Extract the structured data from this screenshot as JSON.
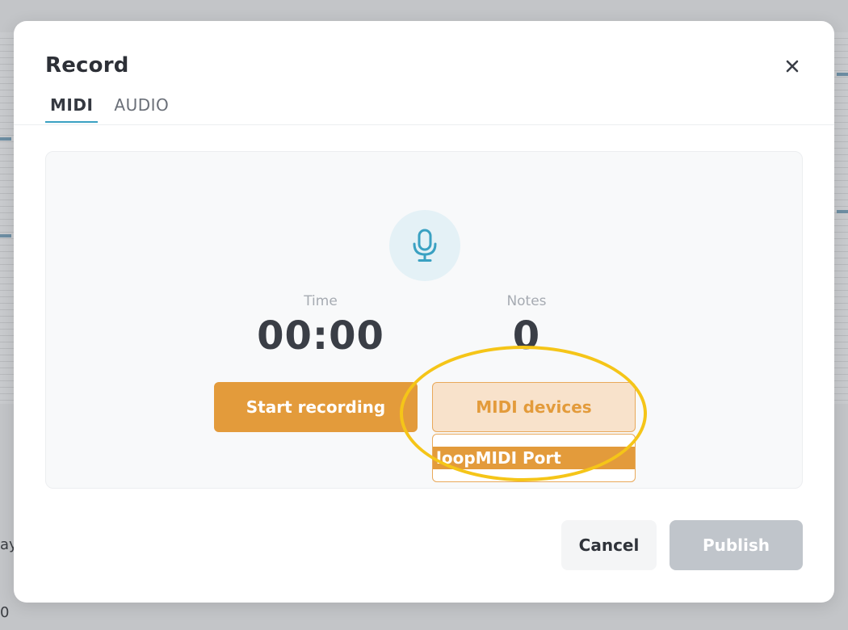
{
  "dialog": {
    "title": "Record",
    "tabs": [
      {
        "label": "MIDI",
        "active": true
      },
      {
        "label": "AUDIO",
        "active": false
      }
    ]
  },
  "recorder": {
    "icon": "microphone-icon",
    "time_label": "Time",
    "time_value": "00:00",
    "notes_label": "Notes",
    "notes_value": "0",
    "start_label": "Start recording",
    "midi_devices_label": "MIDI devices",
    "midi_devices": [
      "loopMIDI Port"
    ]
  },
  "footer": {
    "cancel_label": "Cancel",
    "publish_label": "Publish",
    "publish_disabled": true
  },
  "background": {
    "left_text_1": "ay",
    "left_text_2": "0"
  },
  "colors": {
    "accent_orange": "#e39b3b",
    "accent_orange_light": "#f8e2cb",
    "tab_underline": "#3aa1c2",
    "mic_icon": "#3aa1c2",
    "mic_bg": "#e4f1f6",
    "highlight_annotation": "#f5c518",
    "disabled_button": "#c0c5cb"
  }
}
